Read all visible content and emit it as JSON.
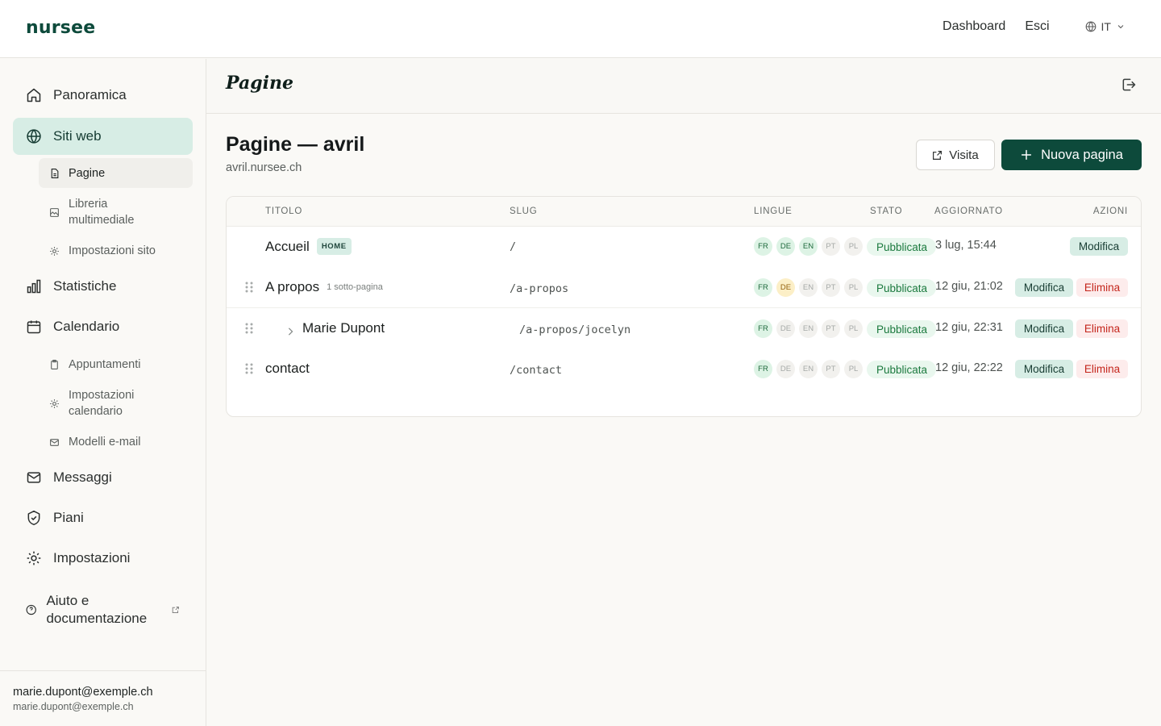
{
  "header": {
    "brand": "nursee",
    "nav": [
      "Dashboard",
      "Esci"
    ],
    "language": "IT"
  },
  "sidebar": {
    "items": [
      {
        "label": "Panoramica",
        "icon": "home-icon"
      },
      {
        "label": "Siti web",
        "icon": "globe-icon"
      },
      {
        "label": "Statistiche",
        "icon": "bar-chart-icon"
      },
      {
        "label": "Calendario",
        "icon": "calendar-icon"
      },
      {
        "label": "Messaggi",
        "icon": "mail-icon"
      },
      {
        "label": "Piani",
        "icon": "shield-icon"
      },
      {
        "label": "Impostazioni",
        "icon": "gear-icon"
      }
    ],
    "sites_sub": [
      {
        "label": "Pagine",
        "icon": "file-icon"
      },
      {
        "label": "Libreria multimediale",
        "icon": "image-icon"
      },
      {
        "label": "Impostazioni sito",
        "icon": "gear-icon"
      }
    ],
    "calendar_sub": [
      {
        "label": "Appuntamenti",
        "icon": "clipboard-icon"
      },
      {
        "label": "Impostazioni calendario",
        "icon": "gear-icon"
      },
      {
        "label": "Modelli e-mail",
        "icon": "mail-icon"
      }
    ],
    "help": {
      "label": "Aiuto e documentazione",
      "icon": "help-circle-icon"
    },
    "user": {
      "name": "marie.dupont@exemple.ch",
      "email": "marie.dupont@exemple.ch"
    }
  },
  "main": {
    "section_title": "Pagine",
    "page_title": "Pagine — avril",
    "domain": "avril.nursee.ch",
    "visit_label": "Visita",
    "new_page_label": "Nuova pagina"
  },
  "table": {
    "columns": [
      "TITOLO",
      "SLUG",
      "LINGUE",
      "STATO",
      "AGGIORNATO",
      "AZIONI"
    ],
    "lang_codes": [
      "FR",
      "DE",
      "EN",
      "PT",
      "PL"
    ],
    "rows": [
      {
        "title": "Accueil",
        "badge": "HOME",
        "slug": "/",
        "langs": [
          "on",
          "on",
          "on",
          "off",
          "off"
        ],
        "status": "Pubblicata",
        "updated": "3 lug, 15:44",
        "edit": "Modifica"
      },
      {
        "title": "A propos",
        "subcount": "1 sotto-pagina",
        "slug": "/a-propos",
        "langs": [
          "on",
          "warn",
          "off",
          "off",
          "off"
        ],
        "status": "Pubblicata",
        "updated": "12 giu, 21:02",
        "edit": "Modifica",
        "delete": "Elimina"
      },
      {
        "title": "Marie Dupont",
        "slug": "/a-propos/jocelyn",
        "langs": [
          "on",
          "off",
          "off",
          "off",
          "off"
        ],
        "status": "Pubblicata",
        "updated": "12 giu, 22:31",
        "edit": "Modifica",
        "delete": "Elimina"
      },
      {
        "title": "contact",
        "slug": "/contact",
        "langs": [
          "on",
          "off",
          "off",
          "off",
          "off"
        ],
        "status": "Pubblicata",
        "updated": "12 giu, 22:22",
        "edit": "Modifica",
        "delete": "Elimina"
      }
    ]
  },
  "colors": {
    "brand": "#0d4a3b",
    "active_bg": "#d7ede5",
    "published": "#1c7a3f",
    "danger": "#c4261d"
  }
}
